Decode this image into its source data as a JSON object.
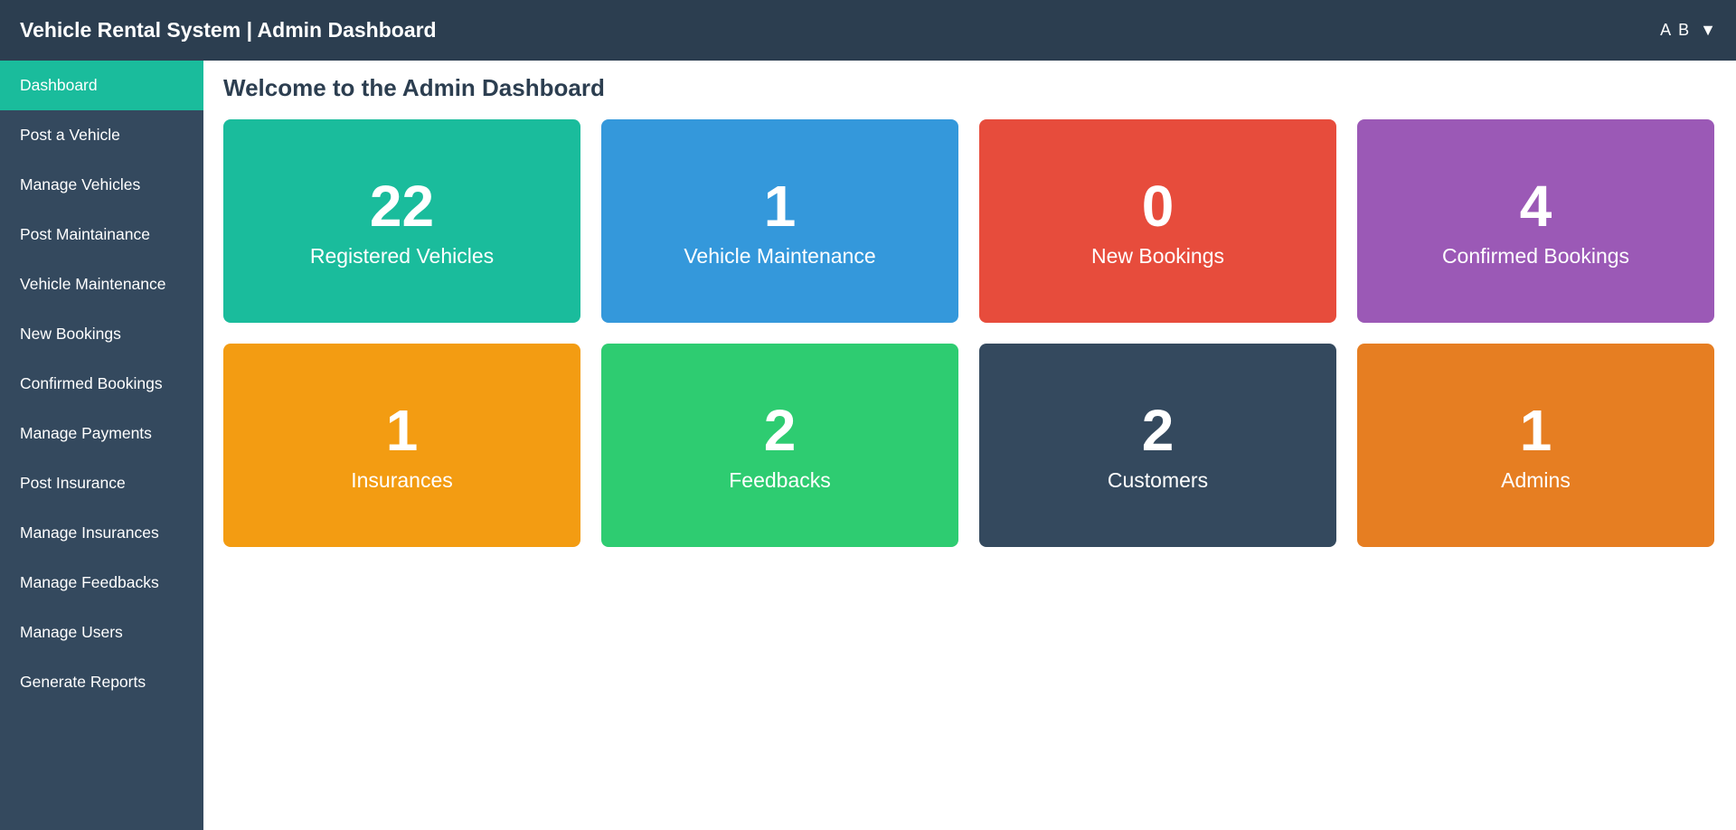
{
  "header": {
    "title": "Vehicle Rental System | Admin Dashboard",
    "user_initials": "A B",
    "caret": "▼"
  },
  "sidebar": {
    "items": [
      {
        "label": "Dashboard",
        "active": true
      },
      {
        "label": "Post a Vehicle"
      },
      {
        "label": "Manage Vehicles"
      },
      {
        "label": "Post Maintainance"
      },
      {
        "label": "Vehicle Maintenance"
      },
      {
        "label": "New Bookings"
      },
      {
        "label": "Confirmed Bookings"
      },
      {
        "label": "Manage Payments"
      },
      {
        "label": "Post Insurance"
      },
      {
        "label": "Manage Insurances"
      },
      {
        "label": "Manage Feedbacks"
      },
      {
        "label": "Manage Users"
      },
      {
        "label": "Generate Reports"
      }
    ]
  },
  "main": {
    "title": "Welcome to the Admin Dashboard",
    "cards": [
      {
        "count": "22",
        "label": "Registered Vehicles",
        "color": "#1abc9c"
      },
      {
        "count": "1",
        "label": "Vehicle Maintenance",
        "color": "#3498db"
      },
      {
        "count": "0",
        "label": "New Bookings",
        "color": "#e74c3c"
      },
      {
        "count": "4",
        "label": "Confirmed Bookings",
        "color": "#9b59b6"
      },
      {
        "count": "1",
        "label": "Insurances",
        "color": "#f39c12"
      },
      {
        "count": "2",
        "label": "Feedbacks",
        "color": "#2ecc71"
      },
      {
        "count": "2",
        "label": "Customers",
        "color": "#34495e"
      },
      {
        "count": "1",
        "label": "Admins",
        "color": "#e67e22"
      }
    ]
  },
  "colors": {
    "header_bg": "#2c3e50",
    "sidebar_bg": "#34495e",
    "active_item": "#1abc9c"
  }
}
